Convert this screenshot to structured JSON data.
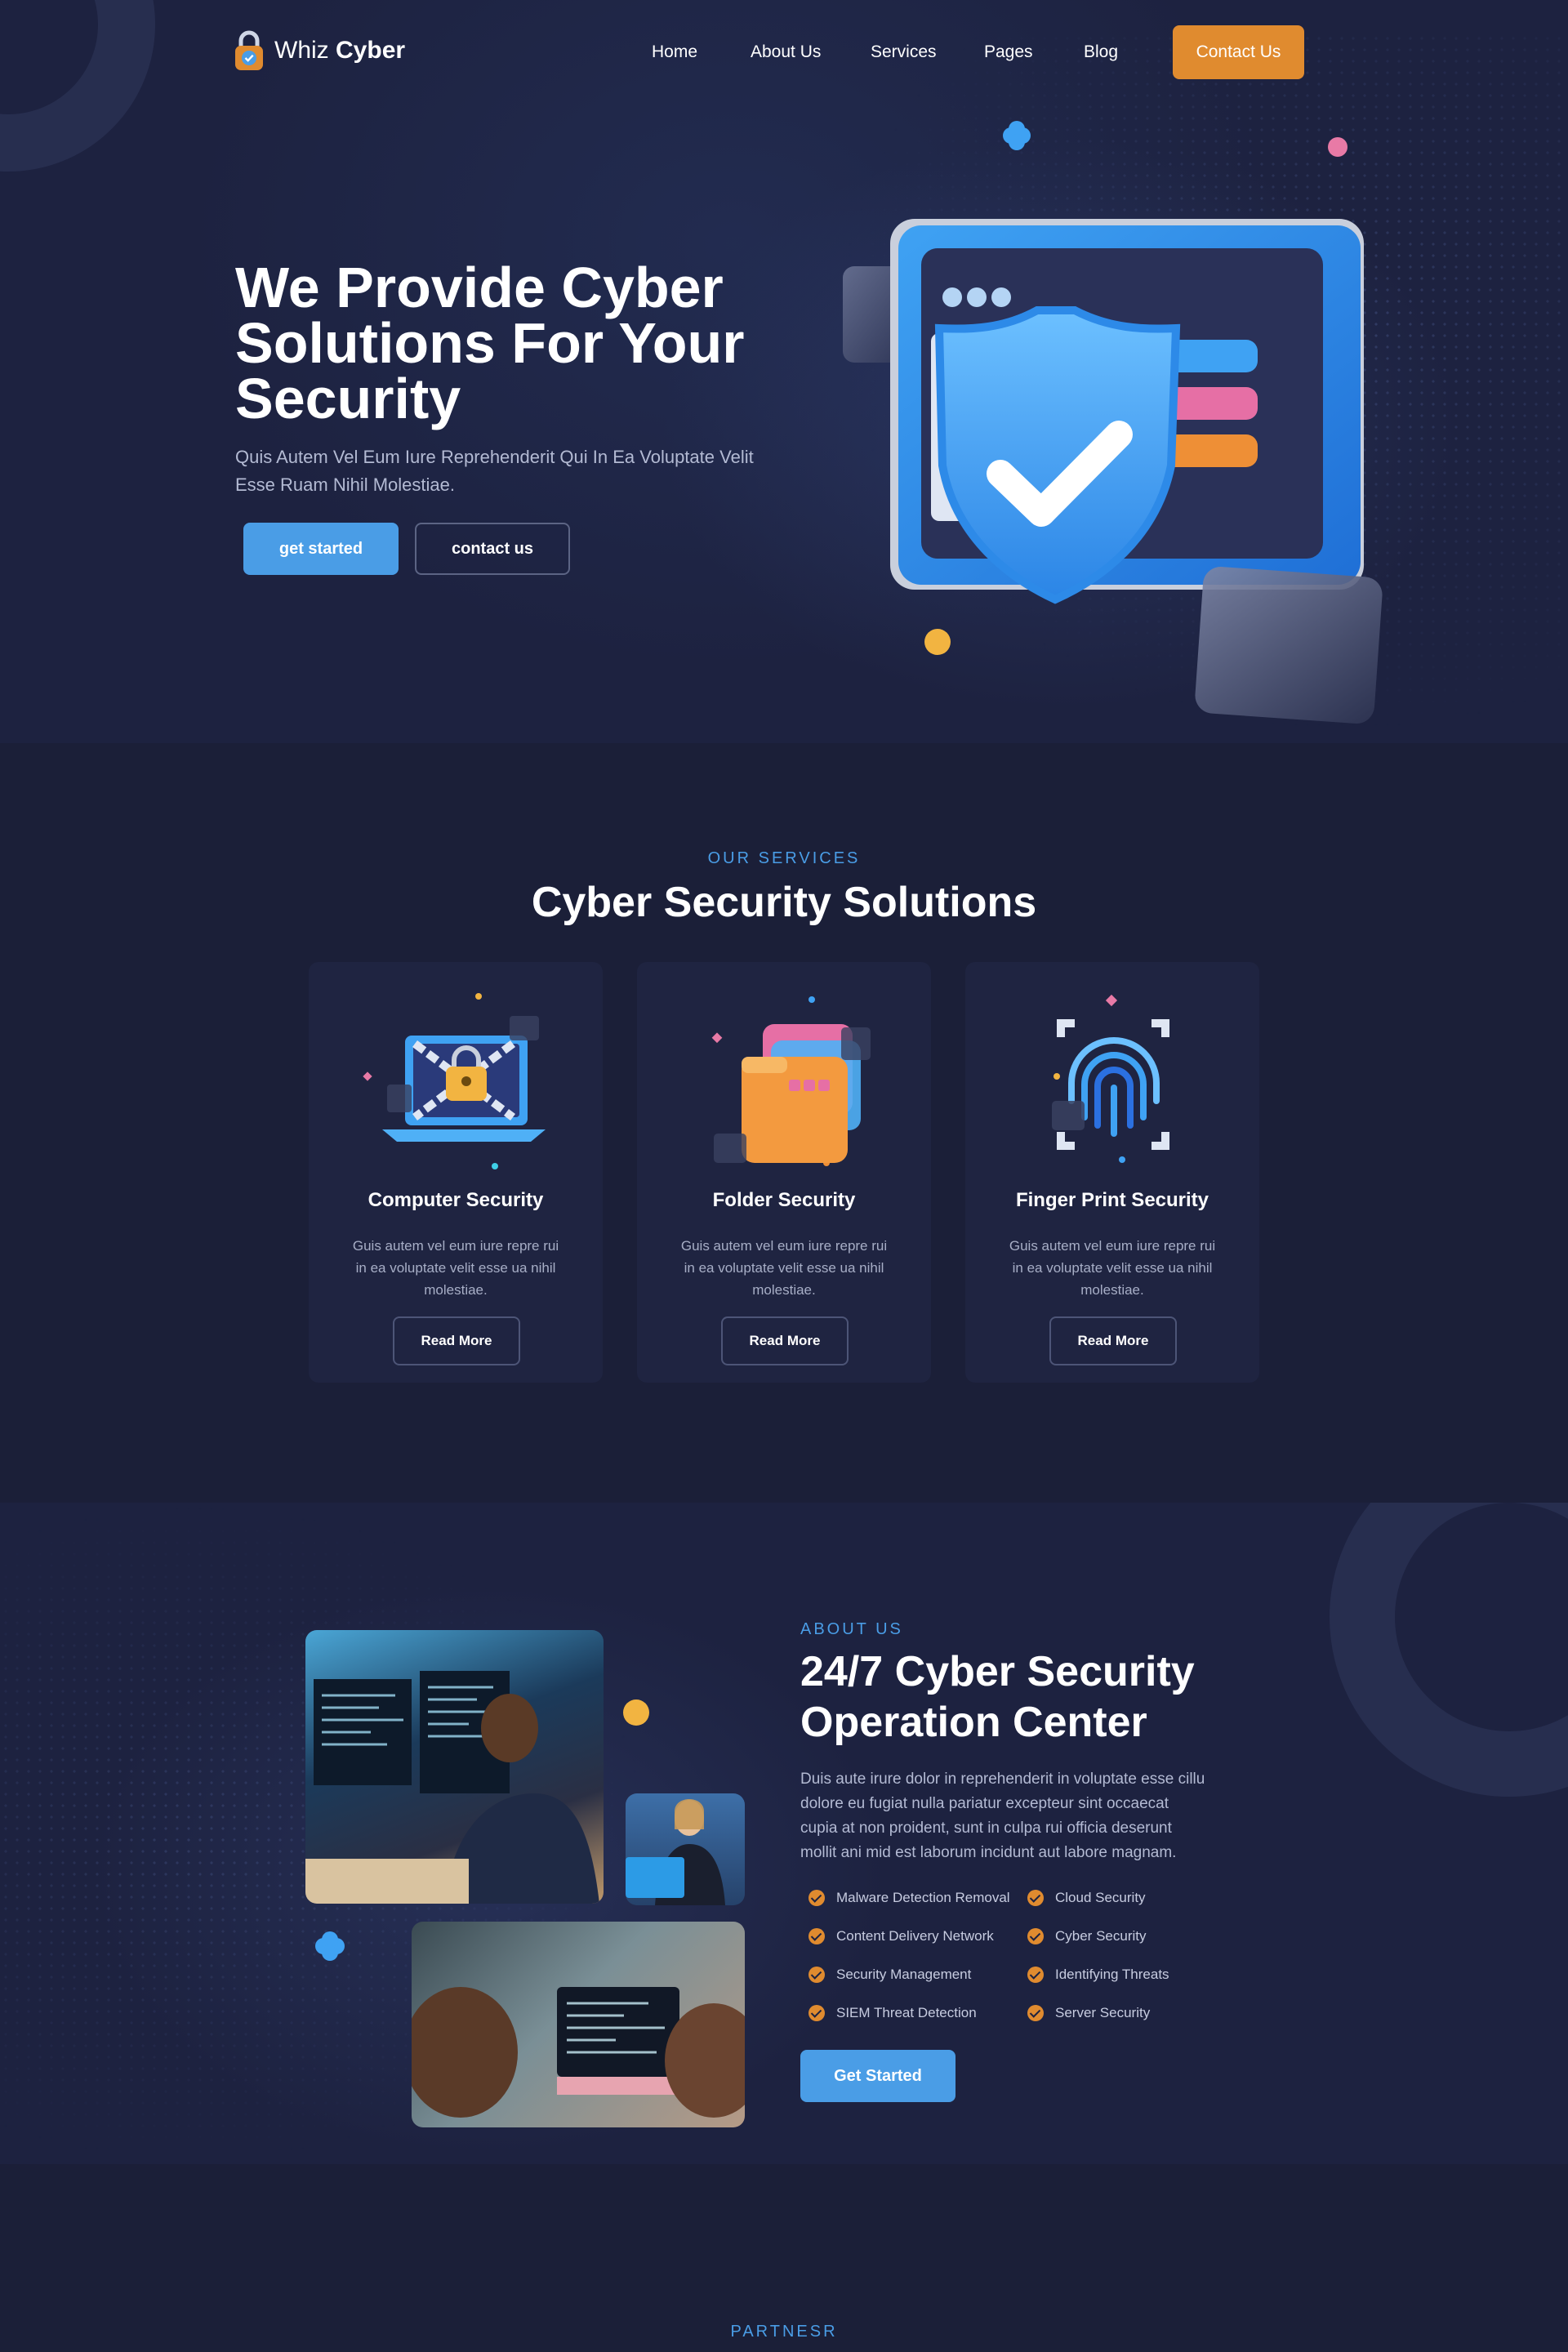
{
  "brand": {
    "name_light": "Whiz",
    "name_bold": "Cyber"
  },
  "nav": {
    "items": [
      "Home",
      "About Us",
      "Services",
      "Pages",
      "Blog"
    ],
    "contact_label": "Contact Us"
  },
  "hero": {
    "title": "We Provide Cyber Solutions For Your Security",
    "subtitle": "Quis Autem Vel Eum Iure Reprehenderit Qui In Ea Voluptate Velit Esse Ruam Nihil Molestiae.",
    "primary_label": "get started",
    "secondary_label": "contact us"
  },
  "services": {
    "eyebrow": "OUR SERVICES",
    "title": "Cyber Security Solutions",
    "cards": [
      {
        "icon": "laptop-lock-icon",
        "title": "Computer Security",
        "text": "Guis autem vel eum iure repre rui in ea voluptate velit esse ua nihil molestiae.",
        "button": "Read More"
      },
      {
        "icon": "folder-stack-icon",
        "title": "Folder Security",
        "text": "Guis autem vel eum iure repre rui in ea voluptate velit esse ua nihil molestiae.",
        "button": "Read More"
      },
      {
        "icon": "fingerprint-icon",
        "title": "Finger Print Security",
        "text": "Guis autem vel eum iure repre rui in ea voluptate velit esse ua nihil molestiae.",
        "button": "Read More"
      }
    ]
  },
  "about": {
    "eyebrow": "ABOUT US",
    "title": "24/7 Cyber Security Operation Center",
    "text": "Duis aute irure dolor in reprehenderit in voluptate esse cillu dolore eu fugiat nulla pariatur excepteur sint occaecat cupia at non proident, sunt in culpa rui officia deserunt mollit ani mid est laborum incidunt aut labore magnam.",
    "features_left": [
      "Malware Detection Removal",
      "Content Delivery Network",
      "Security Management",
      "SIEM Threat Detection"
    ],
    "features_right": [
      "Cloud Security",
      "Cyber Security",
      "Identifying Threats",
      "Server Security"
    ],
    "button": "Get Started"
  },
  "partners": {
    "eyebrow": "PARTNESR"
  },
  "colors": {
    "background": "#1b1f38",
    "accent_blue": "#4a9de6",
    "accent_orange": "#e08b2f"
  }
}
